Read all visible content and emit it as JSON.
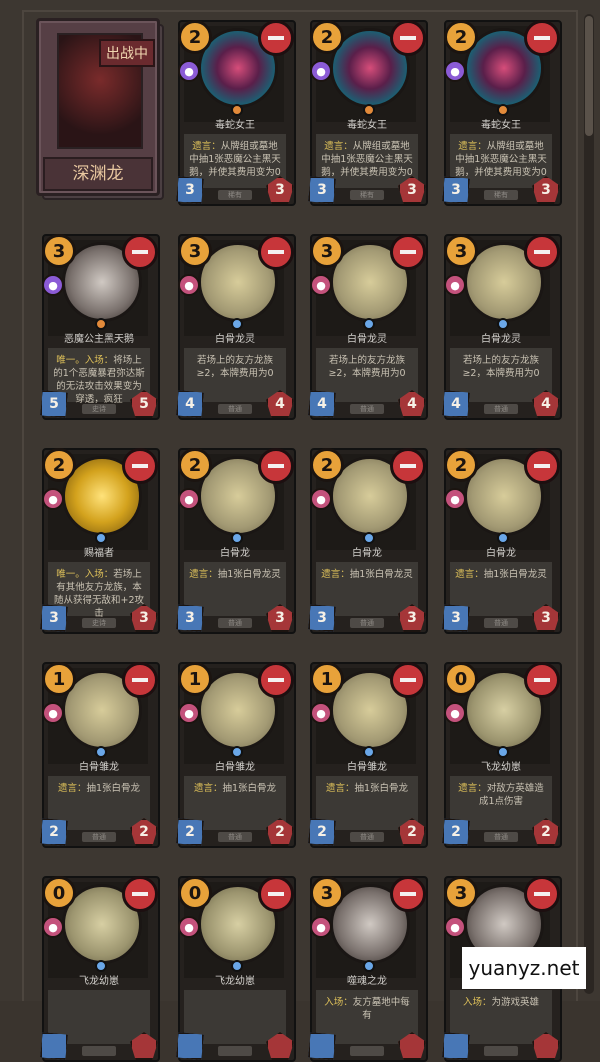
{
  "hero": {
    "status": "出战中",
    "name": "深渊龙"
  },
  "cards": [
    {
      "cost": "2",
      "type": "poison",
      "art": "snake",
      "name": "毒蛇女王",
      "desc": "遗言：从牌组或墓地中抽1张恶魔公主黑天鹅，并使其费用变为0",
      "atk": "3",
      "hp": "3",
      "rarity": "稀有"
    },
    {
      "cost": "2",
      "type": "poison",
      "art": "snake",
      "name": "毒蛇女王",
      "desc": "遗言：从牌组或墓地中抽1张恶魔公主黑天鹅，并使其费用变为0",
      "atk": "3",
      "hp": "3",
      "rarity": "稀有"
    },
    {
      "cost": "2",
      "type": "poison",
      "art": "snake",
      "name": "毒蛇女王",
      "desc": "遗言：从牌组或墓地中抽1张恶魔公主黑天鹅，并使其费用变为0",
      "atk": "3",
      "hp": "3",
      "rarity": "稀有"
    },
    {
      "cost": "3",
      "type": "poison",
      "art": "dark",
      "name": "恶魔公主黑天鹅",
      "desc": "唯一。入场：将场上的1个恶魔暴君弥达斯的无法攻击效果变为穿透，疯狂",
      "atk": "5",
      "hp": "5",
      "rarity": "史诗"
    },
    {
      "cost": "3",
      "type": "dragon",
      "art": "bone",
      "name": "白骨龙灵",
      "desc": "若场上的友方龙族≥2，本牌费用为0",
      "atk": "4",
      "hp": "4",
      "rarity": "普通"
    },
    {
      "cost": "3",
      "type": "dragon",
      "art": "bone",
      "name": "白骨龙灵",
      "desc": "若场上的友方龙族≥2，本牌费用为0",
      "atk": "4",
      "hp": "4",
      "rarity": "普通"
    },
    {
      "cost": "3",
      "type": "dragon",
      "art": "bone",
      "name": "白骨龙灵",
      "desc": "若场上的友方龙族≥2，本牌费用为0",
      "atk": "4",
      "hp": "4",
      "rarity": "普通"
    },
    {
      "cost": "2",
      "type": "dragon",
      "art": "gold",
      "name": "赐福者",
      "desc": "唯一。入场：若场上有其他友方龙族，本随从获得无敌和+2攻击",
      "atk": "3",
      "hp": "3",
      "rarity": "史诗"
    },
    {
      "cost": "2",
      "type": "dragon",
      "art": "bone",
      "name": "白骨龙",
      "desc": "遗言：抽1张白骨龙灵",
      "atk": "3",
      "hp": "3",
      "rarity": "普通"
    },
    {
      "cost": "2",
      "type": "dragon",
      "art": "bone",
      "name": "白骨龙",
      "desc": "遗言：抽1张白骨龙灵",
      "atk": "3",
      "hp": "3",
      "rarity": "普通"
    },
    {
      "cost": "2",
      "type": "dragon",
      "art": "bone",
      "name": "白骨龙",
      "desc": "遗言：抽1张白骨龙灵",
      "atk": "3",
      "hp": "3",
      "rarity": "普通"
    },
    {
      "cost": "1",
      "type": "dragon",
      "art": "bone",
      "name": "白骨雏龙",
      "desc": "遗言：抽1张白骨龙",
      "atk": "2",
      "hp": "2",
      "rarity": "普通"
    },
    {
      "cost": "1",
      "type": "dragon",
      "art": "bone",
      "name": "白骨雏龙",
      "desc": "遗言：抽1张白骨龙",
      "atk": "2",
      "hp": "2",
      "rarity": "普通"
    },
    {
      "cost": "1",
      "type": "dragon",
      "art": "bone",
      "name": "白骨雏龙",
      "desc": "遗言：抽1张白骨龙",
      "atk": "2",
      "hp": "2",
      "rarity": "普通"
    },
    {
      "cost": "0",
      "type": "dragon",
      "art": "frog",
      "name": "飞龙幼崽",
      "desc": "遗言：对敌方英雄造成1点伤害",
      "atk": "2",
      "hp": "2",
      "rarity": "普通"
    },
    {
      "cost": "0",
      "type": "dragon",
      "art": "frog",
      "name": "飞龙幼崽",
      "desc": "",
      "atk": "",
      "hp": "",
      "rarity": ""
    },
    {
      "cost": "0",
      "type": "dragon",
      "art": "frog",
      "name": "飞龙幼崽",
      "desc": "",
      "atk": "",
      "hp": "",
      "rarity": ""
    },
    {
      "cost": "3",
      "type": "dragon",
      "art": "dark",
      "name": "噬魂之龙",
      "desc": "入场：友方墓地中每有",
      "atk": "",
      "hp": "",
      "rarity": ""
    },
    {
      "cost": "3",
      "type": "dragon",
      "art": "dark",
      "name": "",
      "desc": "入场：为游戏英雄",
      "atk": "",
      "hp": "",
      "rarity": ""
    }
  ],
  "watermark": "yuanyz.net",
  "colors": {
    "background": "#3d3731",
    "cost": "#e8a23a",
    "remove": "#c7363a",
    "attack": "#4877b6",
    "health": "#a53638"
  }
}
